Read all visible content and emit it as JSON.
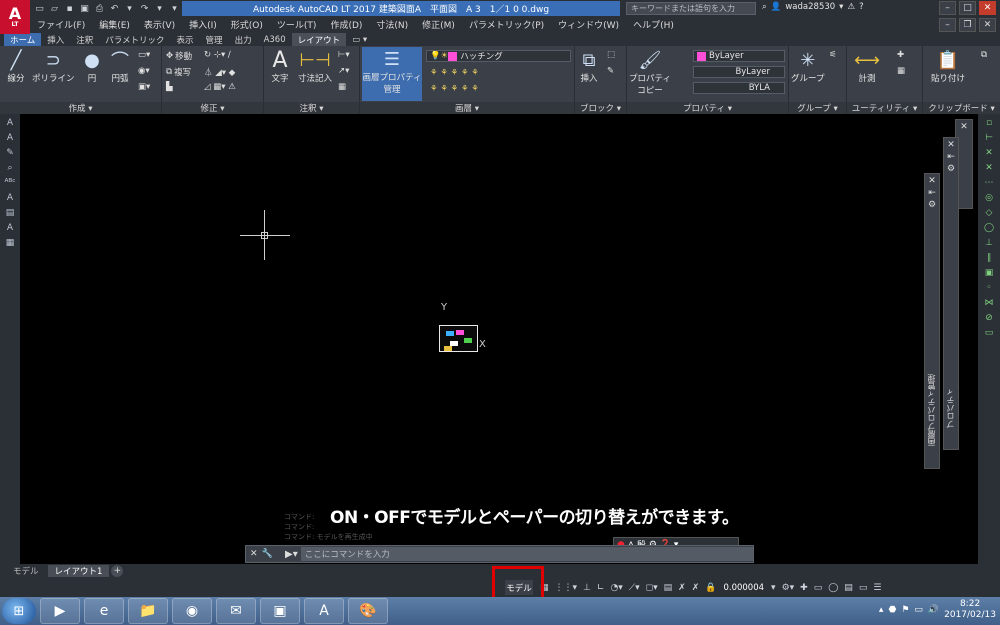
{
  "app": {
    "logo": "A",
    "logo_sub": "LT",
    "title": "Autodesk AutoCAD LT 2017    建築図面A　平面図　A 3　1／1 0 0.dwg",
    "search_placeholder": "キーワードまたは語句を入力",
    "username": "wada28530"
  },
  "menu": [
    "ファイル(F)",
    "編集(E)",
    "表示(V)",
    "挿入(I)",
    "形式(O)",
    "ツール(T)",
    "作成(D)",
    "寸法(N)",
    "修正(M)",
    "パラメトリック(P)",
    "ウィンドウ(W)",
    "ヘルプ(H)"
  ],
  "ribbon_tabs": [
    "ホーム",
    "挿入",
    "注釈",
    "パラメトリック",
    "表示",
    "管理",
    "出力",
    "A360",
    "レイアウト"
  ],
  "ribbon": {
    "draw": {
      "title": "作成 ▾",
      "line": "線分",
      "polyline": "ポリライン",
      "circle": "円",
      "arc": "円弧"
    },
    "modify": {
      "title": "修正 ▾",
      "move": "移動",
      "copy": "複写"
    },
    "annotation": {
      "title": "注釈 ▾",
      "text": "文字",
      "dimension": "寸法記入"
    },
    "layers": {
      "title": "画層 ▾",
      "layer_properties": "画層プロパティ",
      "layer_properties_2": "管理",
      "hatch_layer": "ハッチング"
    },
    "block": {
      "title": "ブロック ▾",
      "insert": "挿入"
    },
    "properties": {
      "title": "プロパティ ▾",
      "match": "プロパティ",
      "match_2": "コピー",
      "color": "ByLayer",
      "linetype": "ByLayer",
      "lineweight": "BYLA"
    },
    "groups": {
      "title": "グループ ▾",
      "group": "グループ"
    },
    "utilities": {
      "title": "ユーティリティ ▾",
      "measure": "計測"
    },
    "clipboard": {
      "title": "クリップボード ▾",
      "paste": "貼り付け"
    }
  },
  "canvas": {
    "ucs_y": "Y",
    "ucs_x": "X",
    "palette_layer": "画層プロパティ管理",
    "palette_props": "プロパティ"
  },
  "caption": "ON・OFFでモデルとペーパーの切り替えができます。",
  "command": {
    "history_1": "コマンド:",
    "history_2": "コマンド:",
    "history_3": "コマンド: モデルを再生成中",
    "placeholder": "ここにコマンドを入力"
  },
  "annotation_tray": "A 殷",
  "layout_tabs": {
    "model": "モデル",
    "layout1": "レイアウト1",
    "add": "+"
  },
  "status": {
    "model_button": "モデル",
    "grid": "▦",
    "scale": "0.000004"
  },
  "taskbar": {
    "time": "8:22",
    "date": "2017/02/13"
  }
}
